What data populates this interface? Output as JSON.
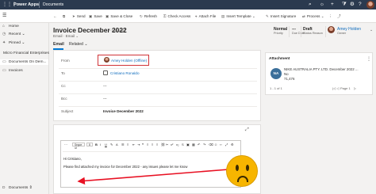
{
  "topbar": {
    "app_name": "Power Apps",
    "area": "Documents"
  },
  "commands": [
    {
      "icon": "send-icon",
      "glyph": "➤",
      "label": "Send"
    },
    {
      "icon": "save-icon",
      "glyph": "▣",
      "label": "Save"
    },
    {
      "icon": "save-close-icon",
      "glyph": "▣",
      "label": "Save & Close"
    },
    {
      "icon": "refresh-icon",
      "glyph": "↻",
      "label": "Refresh"
    },
    {
      "icon": "check-access-icon",
      "glyph": "⚿",
      "label": "Check Access"
    },
    {
      "icon": "attach-icon",
      "glyph": "⌖",
      "label": "Attach File"
    },
    {
      "icon": "template-icon",
      "glyph": "▤",
      "label": "Insert Template"
    },
    {
      "icon": "signature-icon",
      "glyph": "✎",
      "label": "Insert Signature"
    },
    {
      "icon": "process-icon",
      "glyph": "⇄",
      "label": "Process"
    }
  ],
  "nav": {
    "items": [
      {
        "icon": "home-icon",
        "glyph": "⌂",
        "label": "Home"
      },
      {
        "icon": "recent-icon",
        "glyph": "◷",
        "label": "Recent"
      },
      {
        "icon": "pinned-icon",
        "glyph": "✦",
        "label": "Pinned"
      }
    ],
    "section": "Micro Financial Enterprises",
    "entities": [
      {
        "icon": "document-icon",
        "glyph": "▭",
        "label": "Documents On Dem..."
      },
      {
        "icon": "invoice-icon",
        "glyph": "▭",
        "label": "Invoices"
      }
    ]
  },
  "record": {
    "title": "Invoice December 2022",
    "saved_status": "- Unsaved",
    "entity": "Email",
    "form": "Email"
  },
  "header_fields": [
    {
      "value": "Normal",
      "label": "Priority"
    },
    {
      "value": "---",
      "label": "Due Date"
    },
    {
      "value": "Draft",
      "label": "Status Reason"
    },
    {
      "value": "Amey Holden",
      "label": "Owner"
    }
  ],
  "tabs": [
    "Email",
    "Related"
  ],
  "fields": {
    "from": {
      "label": "From",
      "value": "Amey Holden (Offline)"
    },
    "to": {
      "label": "To",
      "value": "Cristiano Ronaldo"
    },
    "cc": {
      "label": "Cc",
      "value": "---"
    },
    "bcc": {
      "label": "Bcc",
      "value": "---"
    },
    "subject": {
      "label": "Subject",
      "value": "Invoice December 2022"
    }
  },
  "attachment": {
    "title": "Attachment",
    "initials": "NA",
    "line1": "NIKE AUSTRALIA PTY. LTD. December 2022 ...",
    "line2": "No",
    "line3": "71,476",
    "range": "1 - 1 of 1",
    "page": "Page 1"
  },
  "editor": {
    "font": "Segoe UI",
    "size": "8",
    "greeting": "Hi Cristiano,",
    "body": "Please find attached my invoice for December 2022 - any issues please let me know"
  },
  "colors": {
    "topbar": "#2b3a4f",
    "accent": "#0078d4",
    "highlight": "#d13438",
    "emoji": "#f7b500"
  }
}
